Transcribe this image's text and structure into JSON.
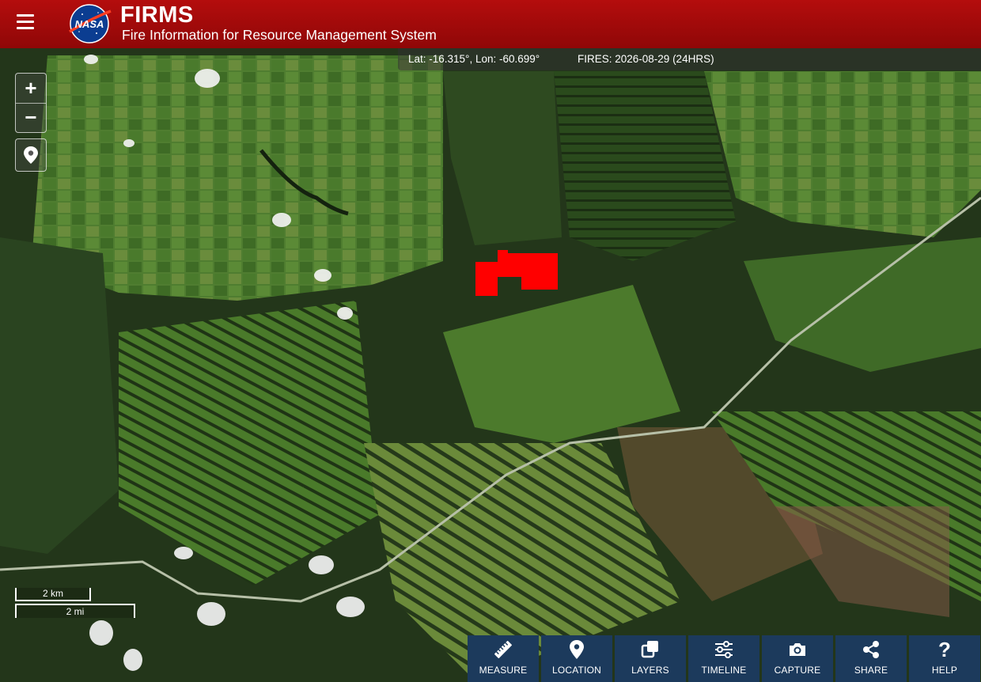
{
  "header": {
    "logo_text": "NASA",
    "title": "FIRMS",
    "subtitle": "Fire Information for Resource Management System"
  },
  "status": {
    "coordinates": "Lat: -16.315°, Lon: -60.699°",
    "fires": "FIRES: 2026-08-29 (24HRS)"
  },
  "zoom": {
    "in_label": "+",
    "out_label": "−"
  },
  "scale": {
    "km_label": "2 km",
    "mi_label": "2 mi"
  },
  "toolbar": {
    "buttons": [
      {
        "label": "MEASURE",
        "icon": "ruler-icon"
      },
      {
        "label": "LOCATION",
        "icon": "map-pin-icon"
      },
      {
        "label": "LAYERS",
        "icon": "layers-icon"
      },
      {
        "label": "TIMELINE",
        "icon": "sliders-icon"
      },
      {
        "label": "CAPTURE",
        "icon": "camera-icon"
      },
      {
        "label": "SHARE",
        "icon": "share-icon"
      },
      {
        "label": "HELP",
        "icon": "question-icon"
      }
    ]
  },
  "colors": {
    "header": "#a50a0a",
    "toolbar": "#1c3a5c",
    "fire_detection": "#ff0000"
  }
}
